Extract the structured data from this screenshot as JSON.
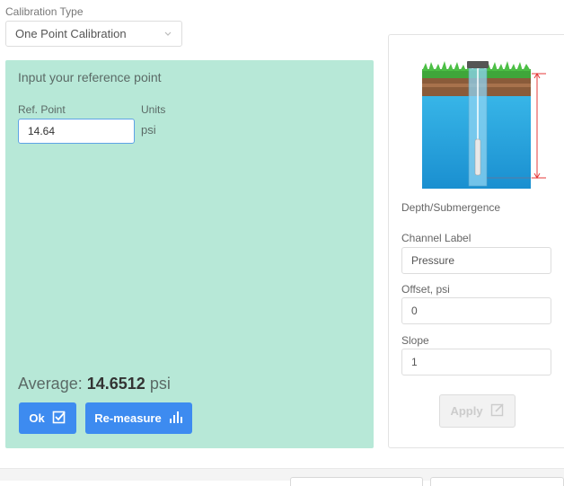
{
  "calibration": {
    "type_label": "Calibration Type",
    "selected": "One Point Calibration"
  },
  "ref_panel": {
    "heading": "Input your reference point",
    "ref_label": "Ref. Point",
    "units_label": "Units",
    "ref_value": "14.64",
    "units_value": "psi",
    "average_label": "Average:",
    "average_value": "14.6512",
    "average_unit": "psi",
    "ok_label": "Ok",
    "remeasure_label": "Re-measure"
  },
  "side_card": {
    "illustration": "well-sensor-illustration",
    "depth_label": "Depth/Submergence",
    "channel_label": "Channel Label",
    "channel_value": "Pressure",
    "offset_label": "Offset, psi",
    "offset_value": "0",
    "slope_label": "Slope",
    "slope_value": "1",
    "apply_label": "Apply"
  },
  "colors": {
    "panel_green": "#b7e8d7",
    "button_blue": "#3d8bf0",
    "input_focus": "#5ea3e6"
  },
  "icons": [
    "chevron-down-icon",
    "check-square-icon",
    "bar-chart-icon",
    "edit-icon"
  ]
}
